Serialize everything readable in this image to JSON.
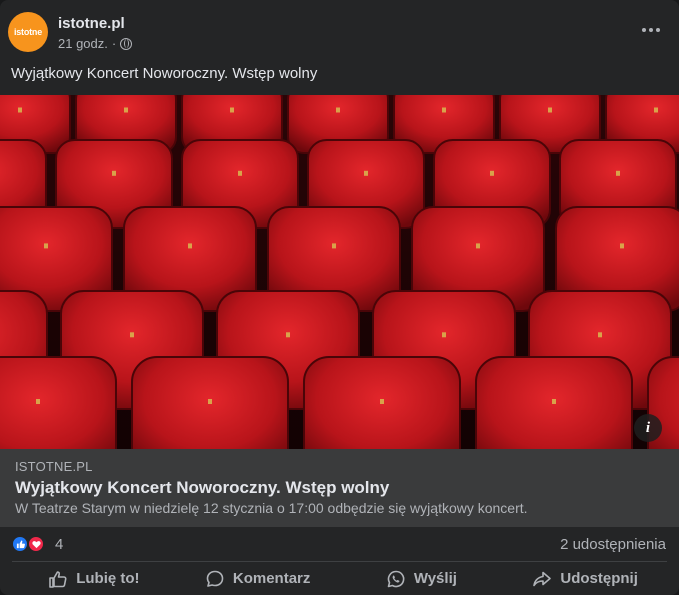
{
  "post": {
    "page_name": "istotne.pl",
    "avatar_text": "istotne",
    "time": "21 godz.",
    "separator": "·",
    "privacy_icon": "globe-icon",
    "text": "Wyjątkowy Koncert Noworoczny. Wstęp wolny"
  },
  "photo": {
    "description_icon": "theater-seats-photo",
    "info_label": "i",
    "colors": {
      "seat": "#c4161c",
      "seat_dark": "#7a0a0e",
      "background": "#1a0405"
    }
  },
  "link": {
    "domain": "ISTOTNE.PL",
    "title": "Wyjątkowy Koncert Noworoczny. Wstęp wolny",
    "description": "W Teatrze Starym w niedzielę 12 stycznia o 17:00 odbędzie się wyjątkowy koncert."
  },
  "stats": {
    "reaction_count": "4",
    "shares": "2 udostępnienia",
    "reactions": [
      "like-icon",
      "love-icon"
    ]
  },
  "actions": {
    "like": "Lubię to!",
    "comment": "Komentarz",
    "send": "Wyślij",
    "share": "Udostępnij"
  },
  "colors": {
    "card_bg": "#242526",
    "link_bg": "#3a3b3c",
    "like_blue": "#2078f4",
    "love_red": "#f0284a",
    "avatar_orange": "#f7941d"
  }
}
